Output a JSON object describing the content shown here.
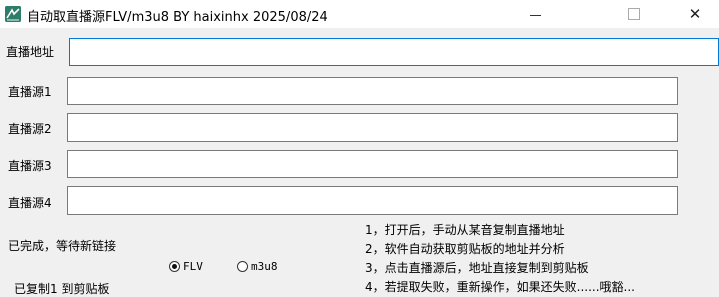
{
  "window": {
    "title": "自动取直播源FLV/m3u8 BY haixinhx 2025/08/24",
    "minimize_glyph": "",
    "close_glyph": "✕"
  },
  "form": {
    "address_label": "直播地址",
    "address_value": "",
    "sources": [
      {
        "label": "直播源1",
        "value": ""
      },
      {
        "label": "直播源2",
        "value": ""
      },
      {
        "label": "直播源3",
        "value": ""
      },
      {
        "label": "直播源4",
        "value": ""
      }
    ]
  },
  "status": {
    "line1": "已完成，等待新链接",
    "line2": "已复制1 到剪贴板"
  },
  "format": {
    "options": [
      {
        "label": "FLV",
        "checked": true
      },
      {
        "label": "m3u8",
        "checked": false
      }
    ]
  },
  "notes": [
    "1，打开后，手动从某音复制直播地址",
    "2，软件自动获取剪贴板的地址并分析",
    "3，点击直播源后，地址直接复制到剪贴板",
    "4，若提取失败，重新操作，如果还失败......哦豁..."
  ]
}
